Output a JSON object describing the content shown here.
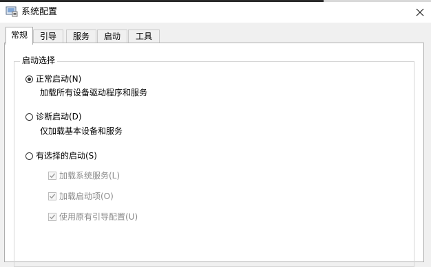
{
  "window": {
    "title": "系统配置"
  },
  "tabs": [
    {
      "label": "常规",
      "active": true
    },
    {
      "label": "引导",
      "active": false
    },
    {
      "label": "服务",
      "active": false
    },
    {
      "label": "启动",
      "active": false
    },
    {
      "label": "工具",
      "active": false
    }
  ],
  "startup_selection": {
    "group_label": "启动选择",
    "options": [
      {
        "label": "正常启动(N)",
        "description": "加载所有设备驱动程序和服务",
        "checked": true
      },
      {
        "label": "诊断启动(D)",
        "description": "仅加载基本设备和服务",
        "checked": false
      },
      {
        "label": "有选择的启动(S)",
        "checked": false
      }
    ],
    "selective_items": [
      {
        "label": "加载系统服务(L)",
        "checked": true,
        "enabled": false
      },
      {
        "label": "加载启动项(O)",
        "checked": true,
        "enabled": false
      },
      {
        "label": "使用原有引导配置(U)",
        "checked": true,
        "enabled": false
      }
    ]
  }
}
